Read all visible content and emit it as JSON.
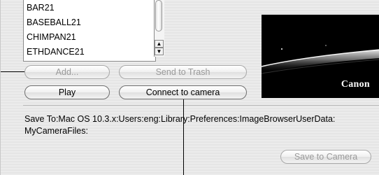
{
  "file_list": {
    "items": [
      "BAR21",
      "BASEBALL21",
      "CHIMPAN21",
      "ETHDANCE21"
    ]
  },
  "buttons": {
    "add": "Add...",
    "send_to_trash": "Send to Trash",
    "play": "Play",
    "connect_to_camera": "Connect to camera",
    "save_to_camera": "Save to Camera"
  },
  "preview": {
    "logo_text": "Canon"
  },
  "save_to": {
    "line1": "Save To:Mac OS 10.3.x:Users:eng:Library:Preferences:ImageBrowserUserData:",
    "line2": "MyCameraFiles:"
  },
  "scrollbar": {
    "up_arrow": "▲",
    "down_arrow": "▼"
  }
}
